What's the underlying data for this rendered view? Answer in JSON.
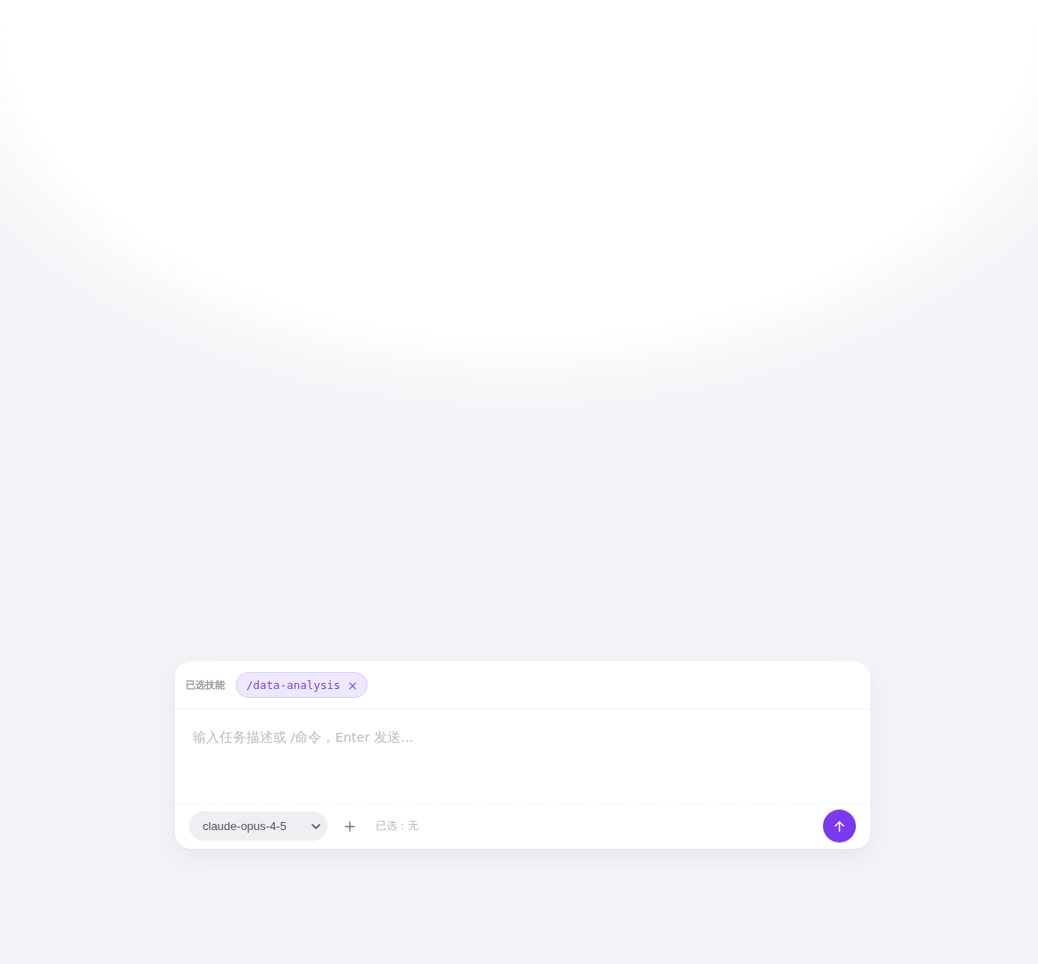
{
  "composer": {
    "skills_label": "已选技能",
    "skills": [
      {
        "label": "/data-analysis",
        "remove": "×"
      }
    ],
    "input": {
      "placeholder": "输入任务描述或 /命令，Enter 发送..."
    },
    "model_select": {
      "value": "claude-opus-4-5"
    },
    "selection_status": "已选：无"
  }
}
